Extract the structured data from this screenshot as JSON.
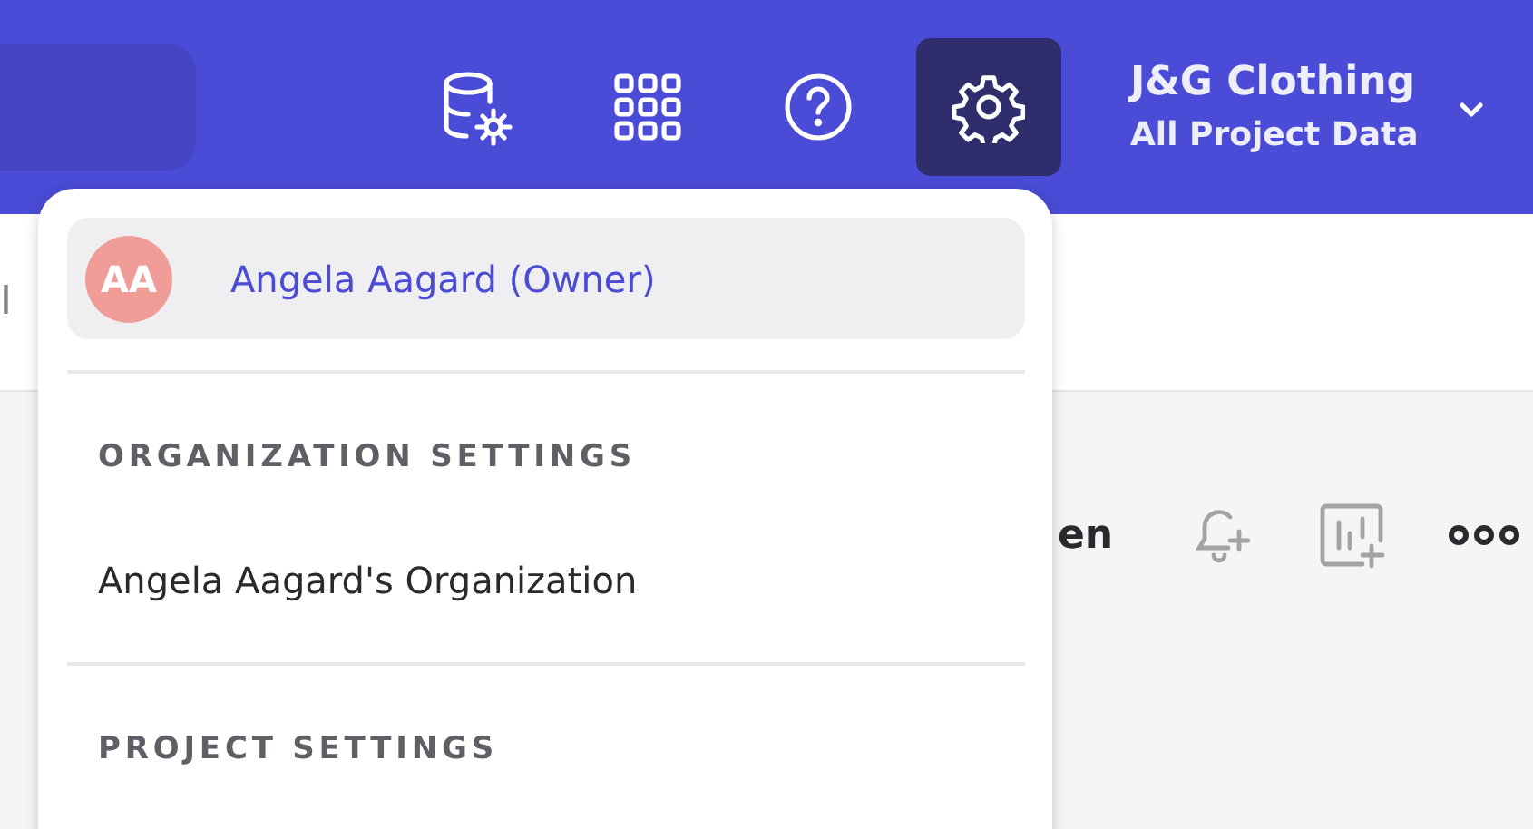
{
  "header": {
    "nav_buttons": [
      {
        "kind": "database",
        "selected": false
      },
      {
        "kind": "apps",
        "selected": false
      },
      {
        "kind": "help",
        "selected": false
      },
      {
        "kind": "settings",
        "selected": true
      }
    ],
    "project": {
      "name": "J&G Clothing",
      "scope": "All Project Data"
    }
  },
  "background": {
    "tab_text": "I",
    "toolbar_text": "en",
    "toolbar_icons": [
      {
        "kind": "bell-plus"
      },
      {
        "kind": "chart-plus"
      },
      {
        "kind": "more"
      }
    ]
  },
  "menu": {
    "user": {
      "initials": "AA",
      "name": "Angela Aagard (Owner)",
      "hovered": true
    },
    "sections": [
      {
        "heading": "ORGANIZATION SETTINGS",
        "items": [
          "Angela Aagard's Organization"
        ]
      },
      {
        "heading": "PROJECT SETTINGS"
      }
    ]
  }
}
